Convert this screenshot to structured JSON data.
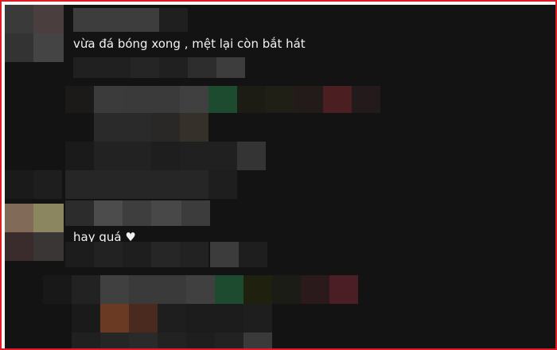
{
  "comments": [
    {
      "text": "vừa đá bóng xong , mệt lại còn bắt hát"
    },
    {
      "text": "hay quá ♥"
    }
  ],
  "colors": {
    "background": "#131313",
    "border": "#e01b24",
    "text": "#f2f2f2"
  }
}
